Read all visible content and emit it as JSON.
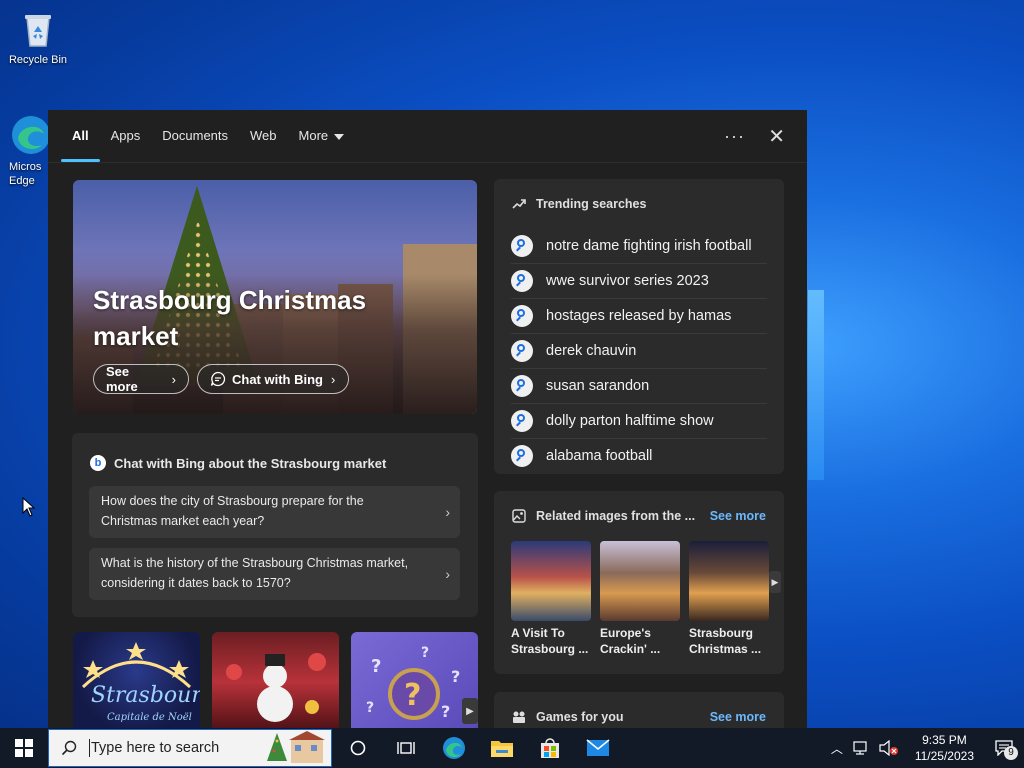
{
  "desktop": {
    "recycle_bin_label": "Recycle Bin",
    "edge_label_line1": "Micros",
    "edge_label_line2": "Edge"
  },
  "search_panel": {
    "tabs": [
      {
        "label": "All",
        "active": true
      },
      {
        "label": "Apps",
        "active": false
      },
      {
        "label": "Documents",
        "active": false
      },
      {
        "label": "Web",
        "active": false
      },
      {
        "label": "More",
        "active": false
      }
    ],
    "more_icon": "ellipsis-icon",
    "close_icon": "close-icon",
    "hero": {
      "title": "Strasbourg Christmas market",
      "see_more_label": "See more",
      "chat_label": "Chat with Bing"
    },
    "chat": {
      "heading": "Chat with Bing about the Strasbourg market",
      "questions": [
        "How does the city of Strasbourg prepare for the Christmas market each year?",
        "What is the history of the Strasbourg Christmas market, considering it dates back to 1570?"
      ]
    },
    "trending": {
      "heading": "Trending searches",
      "items": [
        "notre dame fighting irish football",
        "wwe survivor series 2023",
        "hostages released by hamas",
        "derek chauvin",
        "susan sarandon",
        "dolly parton halftime show",
        "alabama football"
      ]
    },
    "related": {
      "heading": "Related images from the ...",
      "see_more": "See more",
      "images": [
        {
          "caption_line1": "A Visit To",
          "caption_line2": "Strasbourg ..."
        },
        {
          "caption_line1": "Europe's",
          "caption_line2": "Crackin' ..."
        },
        {
          "caption_line1": "Strasbourg",
          "caption_line2": "Christmas ..."
        }
      ]
    },
    "games": {
      "heading": "Games for you",
      "see_more": "See more"
    }
  },
  "taskbar": {
    "search_placeholder": "Type here to search",
    "time": "9:35 PM",
    "date": "11/25/2023",
    "notification_count": "9"
  },
  "colors": {
    "accent": "#4cc2ff",
    "link": "#6bb8ff",
    "panel_bg": "#202020",
    "card_bg": "#2b2b2b"
  }
}
